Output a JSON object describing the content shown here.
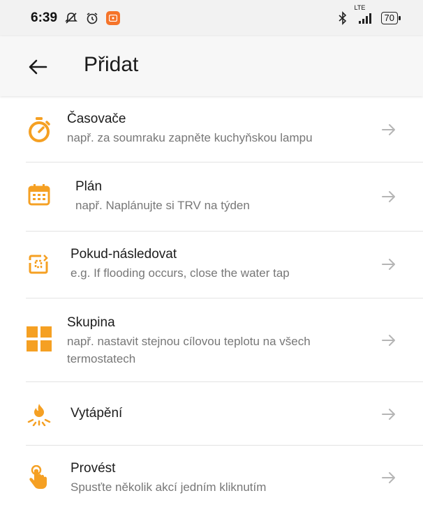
{
  "status_bar": {
    "time": "6:39",
    "network": "LTE",
    "battery": "70",
    "icons": [
      "mute-icon",
      "alarm-icon",
      "app-notification-icon",
      "bluetooth-icon",
      "signal-icon",
      "battery-icon"
    ]
  },
  "app_bar": {
    "title": "Přidat",
    "back_icon": "arrow-left-icon"
  },
  "items": [
    {
      "title": "Časovače",
      "subtitle": "např. za soumraku zapněte kuchyňskou lampu",
      "icon": "stopwatch-icon"
    },
    {
      "title": "Plán",
      "subtitle": "např. Naplánujte si TRV na týden",
      "icon": "calendar-icon"
    },
    {
      "title": "Pokud-následovat",
      "subtitle": "e.g. If flooding occurs, close the water tap",
      "icon": "if-then-icon"
    },
    {
      "title": "Skupina",
      "subtitle": "např. nastavit stejnou cílovou teplotu na všech termostatech",
      "icon": "group-grid-icon"
    },
    {
      "title": "Vytápění",
      "subtitle": "",
      "icon": "heating-flame-icon"
    },
    {
      "title": "Provést",
      "subtitle": "Spusťte několik akcí jedním kliknutím",
      "icon": "tap-hand-icon"
    }
  ],
  "colors": {
    "accent": "#f5a023",
    "divider": "#e3e3e3",
    "arrow": "#b5b5b5"
  }
}
